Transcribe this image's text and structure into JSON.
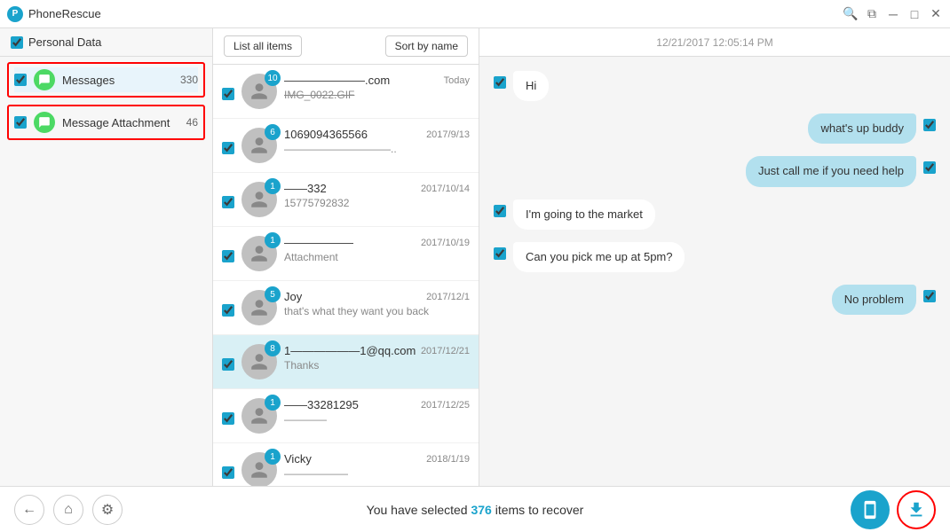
{
  "titleBar": {
    "appName": "PhoneRescue",
    "controls": [
      "search",
      "restore",
      "minimize",
      "maximize",
      "close"
    ]
  },
  "sidebar": {
    "header": "Personal Data",
    "items": [
      {
        "id": "messages",
        "label": "Messages",
        "count": "330",
        "icon": "message"
      },
      {
        "id": "attachments",
        "label": "Message Attachment",
        "count": "46",
        "icon": "message"
      }
    ]
  },
  "middlePanel": {
    "listAllItems": "List all items",
    "sortByName": "Sort by name",
    "conversations": [
      {
        "id": 1,
        "badge": "10",
        "name": "———————.com",
        "date": "Today",
        "preview": "IMG_0022.GIF",
        "previewStyle": "strikethrough",
        "active": false
      },
      {
        "id": 2,
        "badge": "6",
        "name": "1069094365566",
        "date": "2017/9/13",
        "preview": "——————————..",
        "previewStyle": "",
        "active": false
      },
      {
        "id": 3,
        "badge": "1",
        "name": "———332",
        "date": "2017/10/14",
        "preview": "15775792832",
        "previewStyle": "",
        "active": false
      },
      {
        "id": 4,
        "badge": "1",
        "name": "——————",
        "date": "2017/10/19",
        "preview": "Attachment",
        "previewStyle": "",
        "active": false
      },
      {
        "id": 5,
        "badge": "5",
        "name": "Joy",
        "date": "2017/12/1",
        "preview": "that's what they want you back",
        "previewStyle": "",
        "active": false
      },
      {
        "id": 6,
        "badge": "8",
        "name": "1——————1@qq.com",
        "date": "2017/12/21",
        "preview": "Thanks",
        "previewStyle": "",
        "active": true
      },
      {
        "id": 7,
        "badge": "1",
        "name": "——33281295",
        "date": "2017/12/25",
        "preview": "————",
        "previewStyle": "",
        "active": false
      },
      {
        "id": 8,
        "badge": "1",
        "name": "Vicky",
        "date": "2018/1/19",
        "preview": "——————",
        "previewStyle": "",
        "active": false
      }
    ]
  },
  "chatPanel": {
    "timestamp": "12/21/2017 12:05:14 PM",
    "messages": [
      {
        "id": 1,
        "type": "incoming",
        "text": "Hi"
      },
      {
        "id": 2,
        "type": "outgoing",
        "text": "what's up buddy"
      },
      {
        "id": 3,
        "type": "outgoing",
        "text": "Just call me if you need help"
      },
      {
        "id": 4,
        "type": "incoming",
        "text": "I'm going to the market"
      },
      {
        "id": 5,
        "type": "incoming",
        "text": "Can you pick me up at 5pm?"
      },
      {
        "id": 6,
        "type": "outgoing",
        "text": "No problem"
      }
    ]
  },
  "bottomBar": {
    "statusText": "You have selected",
    "count": "376",
    "itemsText": "items to recover"
  }
}
